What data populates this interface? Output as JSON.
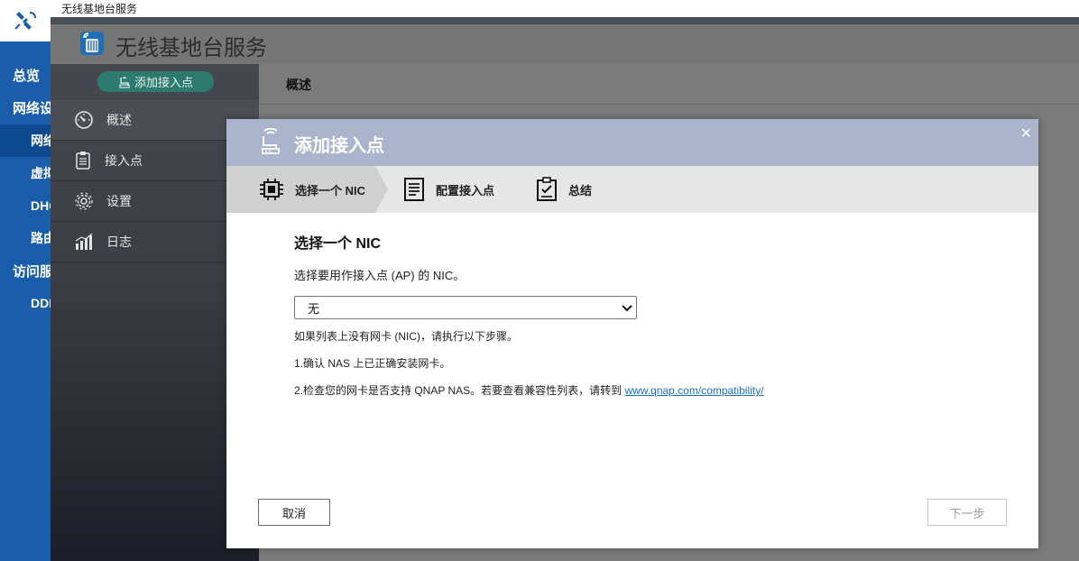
{
  "window": {
    "title": "无线基地台服务"
  },
  "app": {
    "title": "无线基地台服务"
  },
  "left_nav": {
    "items": [
      {
        "label": "总览",
        "level": 1
      },
      {
        "label": "网络设",
        "level": 1
      },
      {
        "label": "网络",
        "level": 2,
        "active": true
      },
      {
        "label": "虚拟",
        "level": 2
      },
      {
        "label": "DHCP",
        "level": 2
      },
      {
        "label": "路由",
        "level": 2
      },
      {
        "label": "访问服",
        "level": 1
      },
      {
        "label": "DDNS",
        "level": 2
      }
    ]
  },
  "sidebar": {
    "add_button": "添加接入点",
    "items": [
      {
        "label": "概述",
        "icon": "gauge-icon"
      },
      {
        "label": "接入点",
        "icon": "clipboard-icon"
      },
      {
        "label": "设置",
        "icon": "gear-icon"
      },
      {
        "label": "日志",
        "icon": "bar-chart-icon"
      }
    ]
  },
  "content": {
    "title": "概述"
  },
  "dialog": {
    "title": "添加接入点",
    "close_symbol": "×",
    "steps": [
      {
        "label": "选择一个 NIC",
        "icon": "chip-icon",
        "active": true
      },
      {
        "label": "配置接入点",
        "icon": "document-icon",
        "active": false
      },
      {
        "label": "总结",
        "icon": "checklist-icon",
        "active": false
      }
    ],
    "heading": "选择一个 NIC",
    "description": "选择要用作接入点 (AP) 的 NIC。",
    "select": {
      "value": "无"
    },
    "note1": "如果列表上没有网卡 (NIC)，请执行以下步骤。",
    "note2": "1.确认 NAS 上已正确安装网卡。",
    "note3_prefix": "2.检查您的网卡是否支持 QNAP NAS。若要查看兼容性列表，请转到 ",
    "note3_link": "www.qnap.com/compatibility/",
    "cancel_button": "取消",
    "next_button": "下一步"
  },
  "colors": {
    "nav_blue": "#1a5dab",
    "dialog_header": "#aab4cd",
    "add_button": "#2d7a6e",
    "link": "#1e6fb8"
  }
}
